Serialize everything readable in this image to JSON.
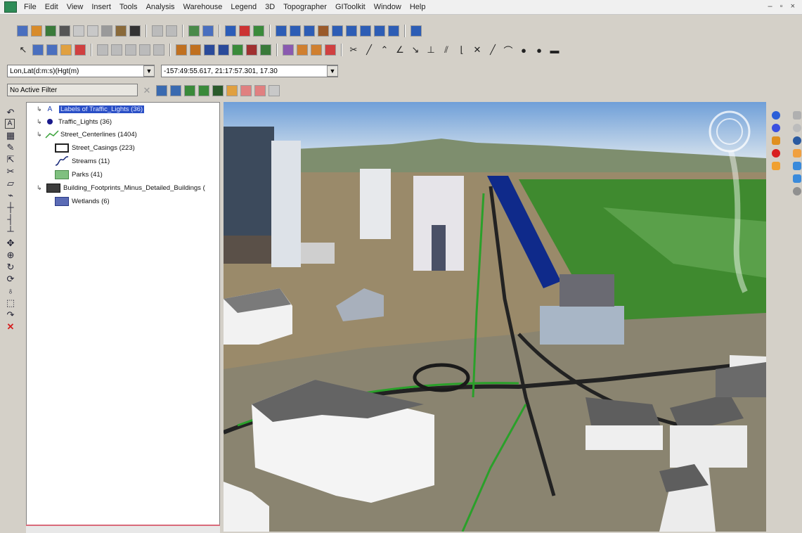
{
  "menu": [
    "File",
    "Edit",
    "View",
    "Insert",
    "Tools",
    "Analysis",
    "Warehouse",
    "Legend",
    "3D",
    "Topographer",
    "GIToolkit",
    "Window",
    "Help"
  ],
  "coord_system": "Lon,Lat(d:m:s)(Hgt(m)",
  "coordinates": "-157:49:55.617, 21:17:57.301, 17.30",
  "filter": "No Active Filter",
  "layers": [
    {
      "label": "Labels of Traffic_Lights (36)",
      "expandable": true,
      "selected": true,
      "symbol": "A",
      "color": "#1f3fae"
    },
    {
      "label": "Traffic_Lights (36)",
      "expandable": true,
      "symbol": "point",
      "color": "#1a1a8c"
    },
    {
      "label": "Street_Centerlines (1404)",
      "expandable": true,
      "symbol": "line",
      "color": "#3aa33a"
    },
    {
      "label": "Street_Casings (223)",
      "expandable": false,
      "symbol": "box",
      "color": "#ffffff"
    },
    {
      "label": "Streams (11)",
      "expandable": false,
      "symbol": "stream",
      "color": "#1a2a7a"
    },
    {
      "label": "Parks (41)",
      "expandable": false,
      "symbol": "fill",
      "color": "#7fc07f"
    },
    {
      "label": "Building_Footprints_Minus_Detailed_Buildings (",
      "expandable": true,
      "symbol": "fill",
      "color": "#3d3d3d"
    },
    {
      "label": "Wetlands (6)",
      "expandable": false,
      "symbol": "fill",
      "color": "#5b6bb5"
    }
  ],
  "icons": {
    "left_tools": [
      "undo-icon",
      "text-icon",
      "table-icon",
      "edit-icon",
      "pointer-icon",
      "scissors-icon",
      "polygon-icon",
      "snap-icon",
      "vertex-icon",
      "join-icon",
      "split-icon",
      "move-icon",
      "center-icon",
      "rotate-icon",
      "refresh-icon",
      "pan-icon",
      "select-icon",
      "redo-icon",
      "delete-icon"
    ],
    "compass": "navigation-compass-icon"
  }
}
